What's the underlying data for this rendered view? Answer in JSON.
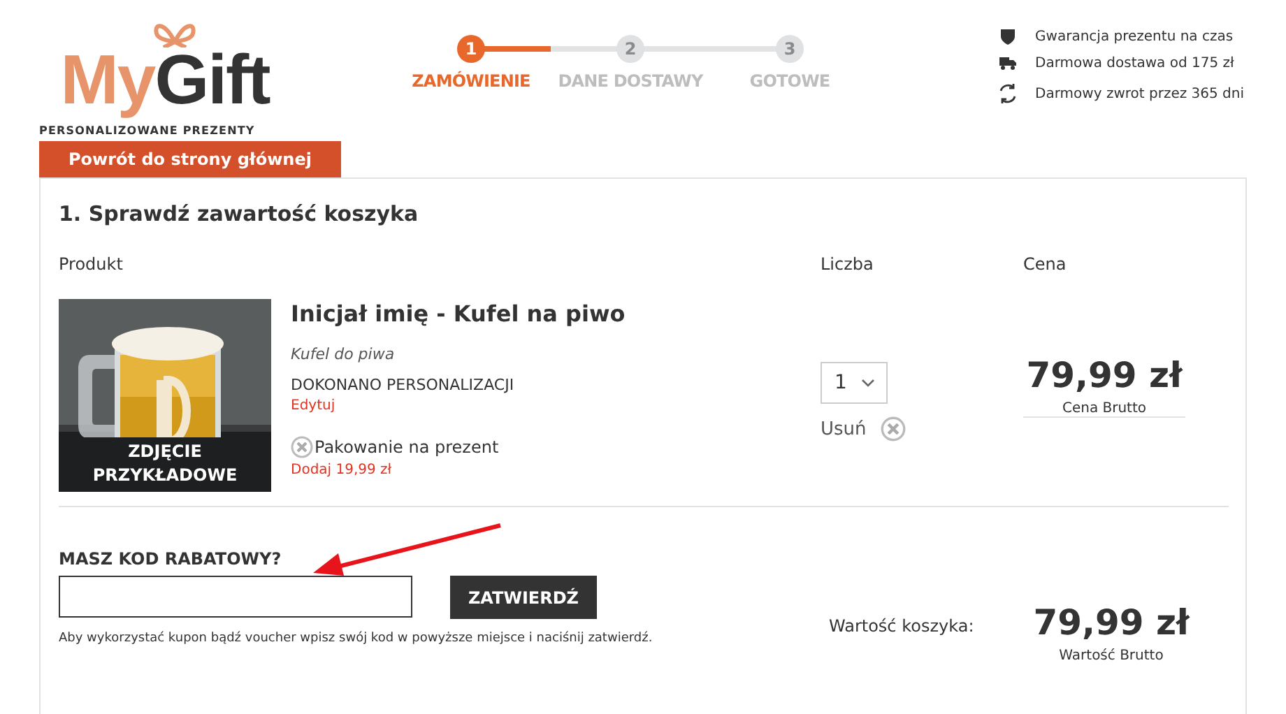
{
  "logo": {
    "brand_first": "My",
    "brand_second": "Gift",
    "tagline": "PERSONALIZOWANE PREZENTY"
  },
  "back_button": "Powrót do strony głównej",
  "steps": [
    {
      "number": "1",
      "label": "ZAMÓWIENIE",
      "selected": true
    },
    {
      "number": "2",
      "label": "DANE DOSTAWY",
      "selected": false
    },
    {
      "number": "3",
      "label": "GOTOWE",
      "selected": false
    }
  ],
  "perks": [
    {
      "kind": "shield",
      "text": "Gwarancja prezentu na czas"
    },
    {
      "kind": "truck",
      "text": "Darmowa dostawa od 175 zł"
    },
    {
      "kind": "return",
      "text": "Darmowy zwrot przez 365 dni"
    }
  ],
  "cart": {
    "title": "1. Sprawdź zawartość koszyka",
    "columns": [
      "Produkt",
      "Liczba",
      "Cena"
    ],
    "items": [
      {
        "image_caption": "ZDJĘCIE PRZYKŁADOWE",
        "name": "Inicjał imię - Kufel na piwo",
        "subtitle": "Kufel do piwa",
        "personalization": "DOKONANO PERSONALIZACJI",
        "edit_link": "Edytuj",
        "gift_wrap": {
          "label": "Pakowanie na prezent",
          "checked": false,
          "price": "Dodaj 19,99 zł"
        },
        "quantity": "1",
        "remove": "Usuń",
        "price": "79,99 zł",
        "price_note": "Cena Brutto"
      }
    ]
  },
  "coupon": {
    "label": "MASZ KOD RABATOWY?",
    "button": "ZATWIERDŹ",
    "help": "Aby wykorzystać kupon bądź voucher wpisz swój kod w powyższe miejsce i naciśnij zatwierdź."
  },
  "summary": {
    "label": "Wartość koszyka:",
    "total": "79,99 zł",
    "note": "Wartość Brutto"
  }
}
